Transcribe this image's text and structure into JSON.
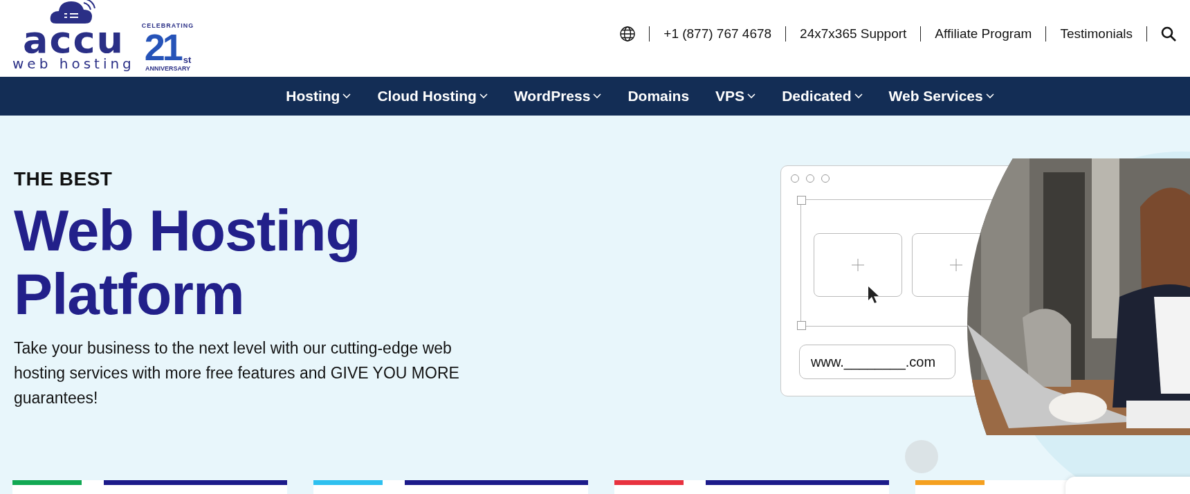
{
  "logo": {
    "brand": "accu",
    "tagline": "web hosting",
    "badge_top": "CELEBRATING",
    "badge_number": "21",
    "badge_suffix": "st",
    "badge_bottom": "ANNIVERSARY"
  },
  "top_links": [
    {
      "kind": "globe"
    },
    {
      "kind": "text",
      "label": "+1 (877) 767 4678"
    },
    {
      "kind": "text",
      "label": "24x7x365 Support"
    },
    {
      "kind": "text",
      "label": "Affiliate Program"
    },
    {
      "kind": "text",
      "label": "Testimonials"
    },
    {
      "kind": "search"
    }
  ],
  "nav": [
    {
      "label": "Hosting",
      "has_menu": true
    },
    {
      "label": "Cloud Hosting",
      "has_menu": true
    },
    {
      "label": "WordPress",
      "has_menu": true
    },
    {
      "label": "Domains",
      "has_menu": false
    },
    {
      "label": "VPS",
      "has_menu": true
    },
    {
      "label": "Dedicated",
      "has_menu": true
    },
    {
      "label": "Web Services",
      "has_menu": true
    }
  ],
  "hero": {
    "eyebrow": "THE BEST",
    "title_lines": [
      "Web Hosting",
      "Platform"
    ],
    "text": "Take your business to the next level with our cutting-edge web hosting services with more free features and GIVE YOU MORE guarantees!",
    "mockup_url": "www.________.com"
  },
  "cards": [
    {
      "color": "#12a853",
      "has_bar": true
    },
    {
      "color": "#2fc0ef",
      "has_bar": true
    },
    {
      "color": "#e8323f",
      "has_bar": true
    },
    {
      "color": "#f5a01f",
      "has_bar": false
    }
  ]
}
